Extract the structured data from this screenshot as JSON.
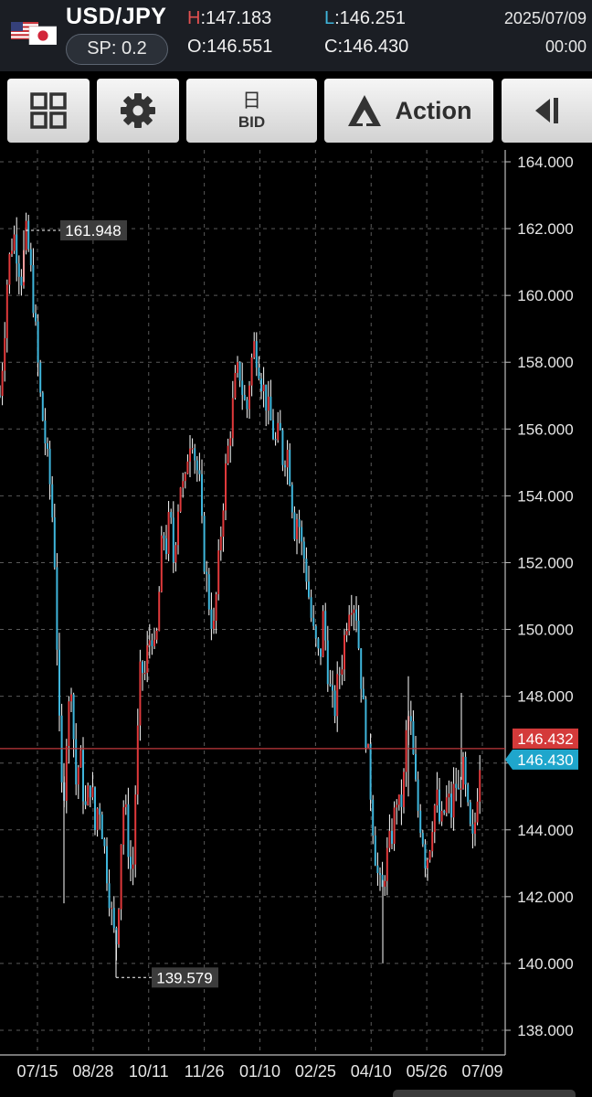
{
  "header": {
    "flag_icon": "us-jp-flag-icon",
    "pair": "USD/JPY",
    "spread": "SP: 0.2",
    "high_key": "H",
    "high_value": ":147.183",
    "low_key": "L",
    "low_value": ":146.251",
    "open": "O:146.551",
    "close": "C:146.430",
    "date": "2025/07/09",
    "time": "00:00"
  },
  "toolbar": {
    "grid_icon": "grid-icon",
    "settings_icon": "gear-icon",
    "timeframe_kanji": "日",
    "price_type": "BID",
    "action_icon": "action-triangle-icon",
    "action_label": "Action",
    "collapse_icon": "collapse-left-icon"
  },
  "colors": {
    "up": "#e0393b",
    "down": "#3fb6dc",
    "wick": "#ffffff",
    "background": "#000000",
    "ask_badge": "#d43a3a",
    "bid_badge": "#1fa6cc"
  },
  "chart_data": {
    "type": "candlestick",
    "title": "",
    "ylim": [
      138,
      164
    ],
    "y_ticks": [
      "164.000",
      "162.000",
      "160.000",
      "158.000",
      "156.000",
      "154.000",
      "152.000",
      "150.000",
      "148.000",
      "146.000",
      "144.000",
      "142.000",
      "140.000",
      "138.000"
    ],
    "x_ticks": [
      "07/15",
      "08/28",
      "10/11",
      "11/26",
      "01/10",
      "02/25",
      "04/10",
      "05/26",
      "07/09"
    ],
    "grid": true,
    "high_marker": "161.948",
    "low_marker": "139.579",
    "ask_price": "146.432",
    "bid_price": "146.430",
    "close_trace": [
      [
        0,
        157.0
      ],
      [
        4,
        158.5
      ],
      [
        8,
        160.5
      ],
      [
        12,
        161.5
      ],
      [
        16,
        161.8
      ],
      [
        20,
        161.0
      ],
      [
        24,
        160.5
      ],
      [
        28,
        161.9
      ],
      [
        32,
        161.2
      ],
      [
        36,
        160.0
      ],
      [
        40,
        158.5
      ],
      [
        44,
        157.0
      ],
      [
        48,
        156.0
      ],
      [
        52,
        155.0
      ],
      [
        56,
        154.0
      ],
      [
        60,
        152.0
      ],
      [
        63,
        149.0
      ],
      [
        66,
        146.0
      ],
      [
        69,
        144.5
      ],
      [
        72,
        146.5
      ],
      [
        75,
        147.5
      ],
      [
        78,
        148.5
      ],
      [
        81,
        146.5
      ],
      [
        84,
        145.0
      ],
      [
        87,
        146.5
      ],
      [
        90,
        145.5
      ],
      [
        93,
        144.5
      ],
      [
        96,
        145.0
      ],
      [
        100,
        145.5
      ],
      [
        104,
        144.0
      ],
      [
        108,
        145.0
      ],
      [
        112,
        144.0
      ],
      [
        116,
        143.0
      ],
      [
        120,
        142.0
      ],
      [
        124,
        141.0
      ],
      [
        127,
        140.5
      ],
      [
        130,
        142.0
      ],
      [
        133,
        144.0
      ],
      [
        136,
        145.0
      ],
      [
        139,
        144.0
      ],
      [
        142,
        143.0
      ],
      [
        145,
        142.5
      ],
      [
        148,
        145.0
      ],
      [
        151,
        147.0
      ],
      [
        154,
        149.0
      ],
      [
        158,
        148.5
      ],
      [
        162,
        149.5
      ],
      [
        166,
        150.0
      ],
      [
        170,
        149.0
      ],
      [
        174,
        151.0
      ],
      [
        178,
        153.0
      ],
      [
        182,
        152.5
      ],
      [
        186,
        153.5
      ],
      [
        190,
        152.0
      ],
      [
        194,
        153.5
      ],
      [
        198,
        154.5
      ],
      [
        202,
        154.0
      ],
      [
        206,
        155.5
      ],
      [
        210,
        156.0
      ],
      [
        214,
        155.0
      ],
      [
        218,
        154.5
      ],
      [
        222,
        152.5
      ],
      [
        226,
        151.5
      ],
      [
        230,
        150.5
      ],
      [
        234,
        150.0
      ],
      [
        238,
        151.5
      ],
      [
        242,
        153.0
      ],
      [
        246,
        154.5
      ],
      [
        250,
        155.5
      ],
      [
        254,
        156.5
      ],
      [
        258,
        157.5
      ],
      [
        262,
        157.8
      ],
      [
        266,
        157.0
      ],
      [
        270,
        156.5
      ],
      [
        274,
        157.8
      ],
      [
        278,
        158.5
      ],
      [
        282,
        158.2
      ],
      [
        286,
        157.5
      ],
      [
        290,
        157.0
      ],
      [
        294,
        156.5
      ],
      [
        298,
        156.0
      ],
      [
        302,
        155.5
      ],
      [
        306,
        156.0
      ],
      [
        310,
        155.0
      ],
      [
        314,
        155.5
      ],
      [
        318,
        154.5
      ],
      [
        322,
        153.0
      ],
      [
        326,
        153.5
      ],
      [
        330,
        152.5
      ],
      [
        334,
        152.0
      ],
      [
        338,
        151.0
      ],
      [
        342,
        150.0
      ],
      [
        346,
        149.5
      ],
      [
        350,
        149.0
      ],
      [
        354,
        150.5
      ],
      [
        358,
        149.0
      ],
      [
        362,
        148.0
      ],
      [
        366,
        147.5
      ],
      [
        370,
        148.5
      ],
      [
        374,
        149.0
      ],
      [
        378,
        150.0
      ],
      [
        382,
        150.8
      ],
      [
        386,
        151.0
      ],
      [
        390,
        150.5
      ],
      [
        394,
        149.0
      ],
      [
        398,
        147.5
      ],
      [
        402,
        146.5
      ],
      [
        406,
        145.0
      ],
      [
        410,
        143.5
      ],
      [
        414,
        142.5
      ],
      [
        418,
        142.0
      ],
      [
        422,
        143.0
      ],
      [
        426,
        143.5
      ],
      [
        430,
        144.0
      ],
      [
        434,
        145.0
      ],
      [
        438,
        144.5
      ],
      [
        442,
        145.5
      ],
      [
        446,
        147.5
      ],
      [
        450,
        147.0
      ],
      [
        454,
        145.5
      ],
      [
        458,
        144.5
      ],
      [
        462,
        144.0
      ],
      [
        466,
        143.0
      ],
      [
        470,
        143.5
      ],
      [
        474,
        144.5
      ],
      [
        478,
        145.0
      ],
      [
        482,
        144.0
      ],
      [
        486,
        144.5
      ],
      [
        490,
        145.0
      ],
      [
        494,
        144.5
      ],
      [
        498,
        145.5
      ],
      [
        502,
        145.0
      ],
      [
        506,
        146.0
      ],
      [
        510,
        145.0
      ],
      [
        514,
        144.0
      ],
      [
        518,
        143.5
      ],
      [
        522,
        145.0
      ],
      [
        526,
        146.4
      ]
    ]
  }
}
